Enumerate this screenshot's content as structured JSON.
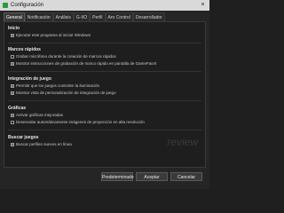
{
  "window": {
    "title": "Configuración",
    "close_icon": "×"
  },
  "tabs": [
    {
      "label": "General",
      "active": true
    },
    {
      "label": "Notificación",
      "active": false
    },
    {
      "label": "Análisis",
      "active": false
    },
    {
      "label": "G-I/O",
      "active": false
    },
    {
      "label": "Perfil",
      "active": false
    },
    {
      "label": "Aro Control",
      "active": false
    },
    {
      "label": "Desarrollador",
      "active": false
    }
  ],
  "sections": {
    "inicio": {
      "title": "Inicio",
      "items": [
        {
          "label": "Ejecutar este programa al iniciar Windows",
          "checked": true
        }
      ]
    },
    "marcos": {
      "title": "Marcos rápidos",
      "items": [
        {
          "label": "Grabar micrófono durante la creación de marcos rápidos",
          "checked": false
        },
        {
          "label": "Mostrar instrucciones de grabación de marco rápido en pantalla de GameFacet",
          "checked": true
        }
      ]
    },
    "integracion": {
      "title": "Integración de juego",
      "items": [
        {
          "label": "Permitir que los juegos controlen la iluminación",
          "checked": true
        },
        {
          "label": "Mostrar vista de personalización de integración de juego",
          "checked": true
        }
      ]
    },
    "graficas": {
      "title": "Gráficas",
      "items": [
        {
          "label": "Activar gráficas mejoradas",
          "checked": true
        },
        {
          "label": "Desescalar automáticamente imágenes de proyección en alta resolución",
          "checked": false
        }
      ]
    },
    "buscar": {
      "title": "Buscar juegos",
      "items": [
        {
          "label": "Buscar perfiles nuevos en línea",
          "checked": true
        }
      ]
    }
  },
  "watermark": "review",
  "buttons": {
    "defaults": "Predeterminado",
    "accept": "Aceptar",
    "cancel": "Cancelar"
  }
}
